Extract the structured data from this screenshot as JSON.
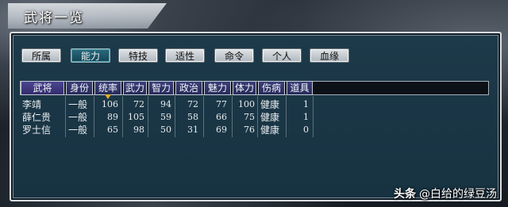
{
  "window": {
    "title": "武将一览"
  },
  "tabs": [
    {
      "label": "所属",
      "active": false
    },
    {
      "label": "能力",
      "active": true
    },
    {
      "label": "特技",
      "active": false
    },
    {
      "label": "适性",
      "active": false
    },
    {
      "label": "命令",
      "active": false
    },
    {
      "label": "个人",
      "active": false
    },
    {
      "label": "血缘",
      "active": false
    }
  ],
  "table": {
    "headers": [
      "武将",
      "身份",
      "统率",
      "武力",
      "智力",
      "政治",
      "魅力",
      "体力",
      "伤病",
      "道具"
    ],
    "sorted_column": "统率",
    "rows": [
      [
        "李靖",
        "一般",
        "106",
        "72",
        "94",
        "72",
        "77",
        "100",
        "健康",
        "1"
      ],
      [
        "薛仁贵",
        "一般",
        "89",
        "105",
        "59",
        "58",
        "66",
        "75",
        "健康",
        "1"
      ],
      [
        "罗士信",
        "一般",
        "65",
        "98",
        "50",
        "31",
        "69",
        "76",
        "健康",
        "0"
      ]
    ]
  },
  "watermark": {
    "brand": "头条",
    "author": "@白给的绿豆汤"
  }
}
